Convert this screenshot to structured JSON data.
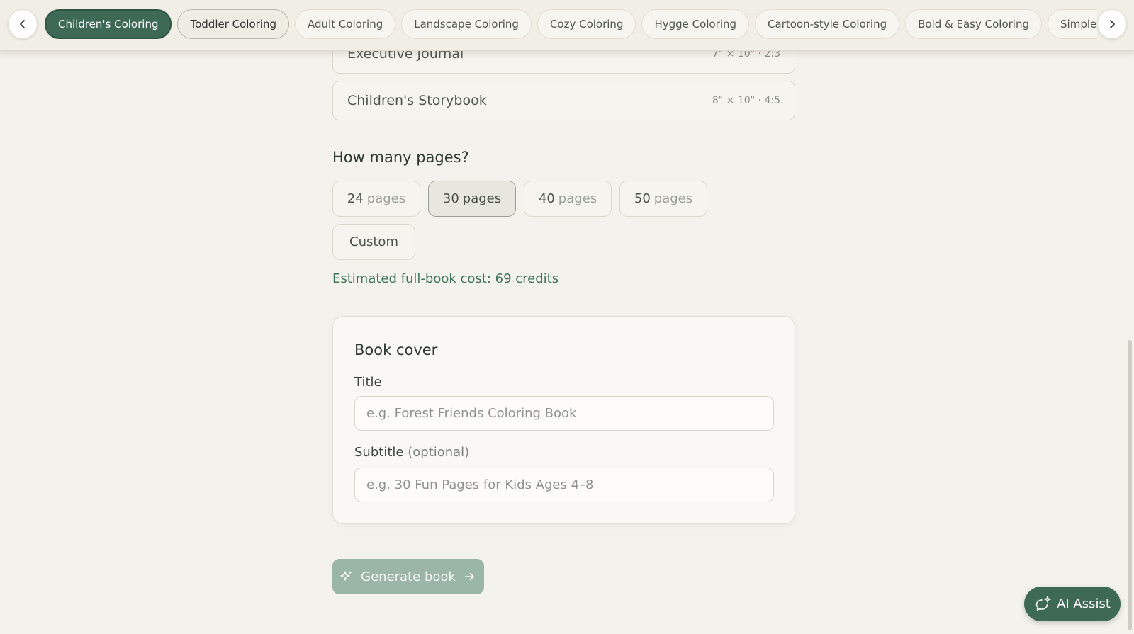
{
  "categories": [
    {
      "label": "Children's Coloring",
      "state": "active"
    },
    {
      "label": "Toddler Coloring",
      "state": "hover"
    },
    {
      "label": "Adult Coloring",
      "state": ""
    },
    {
      "label": "Landscape Coloring",
      "state": ""
    },
    {
      "label": "Cozy Coloring",
      "state": ""
    },
    {
      "label": "Hygge Coloring",
      "state": ""
    },
    {
      "label": "Cartoon-style Coloring",
      "state": ""
    },
    {
      "label": "Bold & Easy Coloring",
      "state": ""
    },
    {
      "label": "Simple Mandala Coloring",
      "state": ""
    }
  ],
  "nav": {
    "prev_icon": "chevron-left-icon",
    "next_icon": "chevron-right-icon"
  },
  "formats": [
    {
      "name": "Executive Journal",
      "meta": "7\" × 10\" · 2:3"
    },
    {
      "name": "Children's Storybook",
      "meta": "8\" × 10\" · 4:5"
    }
  ],
  "pages": {
    "heading": "How many pages?",
    "word": "pages",
    "options": [
      {
        "num": "24",
        "selected": false
      },
      {
        "num": "30",
        "selected": true
      },
      {
        "num": "40",
        "selected": false
      },
      {
        "num": "50",
        "selected": false
      }
    ],
    "custom_label": "Custom"
  },
  "cost_text": "Estimated full-book cost: 69 credits",
  "cover": {
    "heading": "Book cover",
    "title_label": "Title",
    "title_value": "",
    "title_placeholder": "e.g. Forest Friends Coloring Book",
    "subtitle_label": "Subtitle",
    "subtitle_optional": "(optional)",
    "subtitle_value": "",
    "subtitle_placeholder": "e.g. 30 Fun Pages for Kids Ages 4–8"
  },
  "generate": {
    "label": "Generate book",
    "icon": "sparkle-icon",
    "trailing_icon": "arrow-right-icon"
  },
  "ai_assist": {
    "label": "AI Assist",
    "icon": "chat-sparkle-icon"
  },
  "colors": {
    "accent": "#3e6a55",
    "accent_muted": "#9bb5a6",
    "cost_text": "#3f7559",
    "background": "#f4f2ec"
  }
}
